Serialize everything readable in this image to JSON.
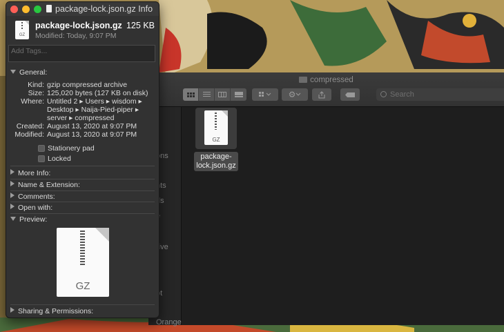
{
  "finder": {
    "title": "compressed",
    "search_placeholder": "Search",
    "sidebar_fragments": [
      "ons",
      "nts",
      "ds",
      "e",
      "rive",
      "pt",
      "Orange"
    ],
    "file": {
      "name_line1": "package-",
      "name_line2": "lock.json.gz",
      "icon_tag": "GZ"
    }
  },
  "info": {
    "title": "package-lock.json.gz Info",
    "file_name": "package-lock.json.gz",
    "file_size": "125 KB",
    "modified_summary": "Modified: Today, 9:07 PM",
    "icon_tag": "GZ",
    "tags_placeholder": "Add Tags...",
    "general": {
      "label": "General:",
      "kind_key": "Kind:",
      "kind": "gzip compressed archive",
      "size_key": "Size:",
      "size": "125,020 bytes (127 KB on disk)",
      "where_key": "Where:",
      "where_l1": "Untitled 2 ▸ Users ▸ wisdom ▸",
      "where_l2": "Desktop ▸ Naija-Pied-piper ▸",
      "where_l3": "server ▸ compressed",
      "created_key": "Created:",
      "created": "August 13, 2020 at 9:07 PM",
      "modified_key": "Modified:",
      "modified": "August 13, 2020 at 9:07 PM",
      "stationery": "Stationery pad",
      "locked": "Locked"
    },
    "sections": {
      "more_info": "More Info:",
      "name_ext": "Name & Extension:",
      "comments": "Comments:",
      "open_with": "Open with:",
      "preview": "Preview:",
      "sharing": "Sharing & Permissions:"
    },
    "preview_tag": "GZ"
  },
  "colors": {
    "close": "#fe5f57",
    "minimize": "#febc2e",
    "zoom": "#28c840"
  }
}
